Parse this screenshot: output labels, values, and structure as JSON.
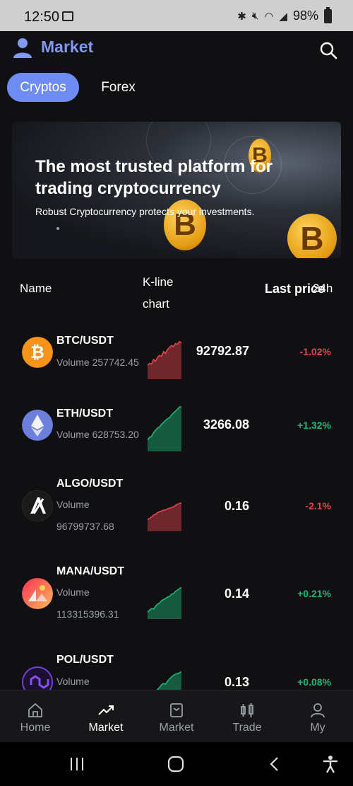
{
  "status_bar": {
    "time": "12:50",
    "battery": "98%"
  },
  "header": {
    "title": "Market"
  },
  "tabs": [
    {
      "label": "Cryptos",
      "active": true
    },
    {
      "label": "Forex",
      "active": false
    }
  ],
  "banner": {
    "headline": "The most trusted platform for trading cryptocurrency",
    "subline": "Robust Cryptocurrency protects your investments."
  },
  "columns": {
    "name": "Name",
    "kline": "K-line chart",
    "price": "Last price",
    "change": "24h"
  },
  "rows": [
    {
      "pair": "BTC/USDT",
      "volume": "Volume 257742.45",
      "price": "92792.87",
      "change": "-1.02%",
      "trend": "down",
      "icon": "bitcoin-icon",
      "color": "#f7931a",
      "spark": [
        0.35,
        0.4,
        0.38,
        0.5,
        0.45,
        0.55,
        0.6,
        0.58,
        0.7,
        0.65,
        0.75,
        0.8,
        0.85,
        0.82,
        0.9,
        0.88,
        0.95,
        0.92
      ]
    },
    {
      "pair": "ETH/USDT",
      "volume": "Volume 628753.20",
      "price": "3266.08",
      "change": "+1.32%",
      "trend": "up",
      "icon": "ethereum-icon",
      "color": "#6d7fdc",
      "spark": [
        0.25,
        0.3,
        0.32,
        0.4,
        0.45,
        0.5,
        0.52,
        0.58,
        0.62,
        0.66,
        0.7,
        0.72,
        0.78,
        0.82,
        0.86,
        0.9,
        0.95,
        0.96
      ]
    },
    {
      "pair": "ALGO/USDT",
      "volume": "Volume 96799737.68",
      "price": "0.16",
      "change": "-2.1%",
      "trend": "down",
      "icon": "algorand-icon",
      "color": "#1a1a1a",
      "spark": [
        0.35,
        0.38,
        0.42,
        0.48,
        0.5,
        0.55,
        0.58,
        0.6,
        0.62,
        0.63,
        0.66,
        0.68,
        0.7,
        0.72,
        0.76,
        0.8,
        0.82,
        0.84
      ]
    },
    {
      "pair": "MANA/USDT",
      "volume": "Volume 113315396.31",
      "price": "0.14",
      "change": "+0.21%",
      "trend": "up",
      "icon": "decentraland-icon",
      "color": "#ff4f6b",
      "spark": [
        0.2,
        0.25,
        0.3,
        0.28,
        0.36,
        0.42,
        0.45,
        0.52,
        0.55,
        0.58,
        0.62,
        0.64,
        0.7,
        0.72,
        0.78,
        0.82,
        0.86,
        0.9
      ]
    },
    {
      "pair": "POL/USDT",
      "volume": "Volume",
      "price": "0.13",
      "change": "+0.08%",
      "trend": "up",
      "icon": "polygon-icon",
      "color": "#7b3fe4",
      "spark": [
        0.2,
        0.25,
        0.32,
        0.3,
        0.38,
        0.45,
        0.5,
        0.58,
        0.62,
        0.6,
        0.68,
        0.75,
        0.8,
        0.85,
        0.88,
        0.9,
        0.92,
        0.95
      ]
    }
  ],
  "bottom_nav": [
    {
      "label": "Home",
      "icon": "home-icon",
      "active": false
    },
    {
      "label": "Market",
      "icon": "trending-icon",
      "active": true
    },
    {
      "label": "Market",
      "icon": "market-box-icon",
      "active": false
    },
    {
      "label": "Trade",
      "icon": "candles-icon",
      "active": false
    },
    {
      "label": "My",
      "icon": "user-icon",
      "active": false
    }
  ],
  "colors": {
    "accent": "#6e8cf3",
    "up": "#1fb67a",
    "down": "#e2464f"
  }
}
